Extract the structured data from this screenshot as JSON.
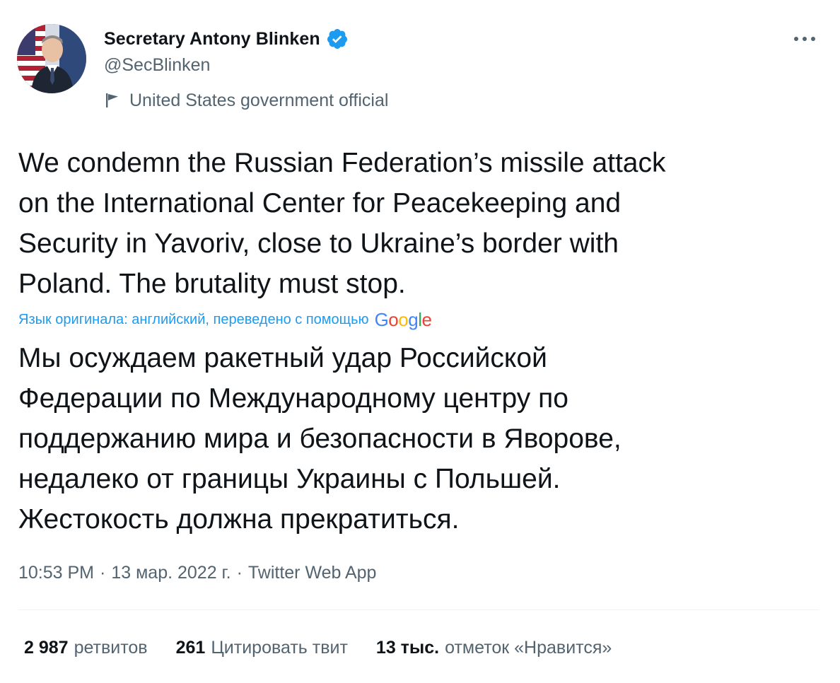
{
  "author": {
    "display_name": "Secretary Antony Blinken",
    "handle": "@SecBlinken",
    "label": "United States government official",
    "verified": true
  },
  "tweet": {
    "text": "We condemn the Russian Federation’s missile attack\non the International Center for Peacekeeping and\nSecurity in Yavoriv, close to Ukraine’s border with\nPoland. The brutality must stop.",
    "translation_note": "Язык оригинала: английский, переведено с помощью",
    "translation_provider": "Google",
    "translated_text": "Мы осуждаем ракетный удар Российской\nФедерации по Международному центру по\nподдержанию мира и безопасности в Яворове,\nнедалеко от границы Украины с Польшей.\nЖестокость должна прекратиться."
  },
  "meta": {
    "time": "10:53 PM",
    "date": "13 мар. 2022 г.",
    "source": "Twitter Web App",
    "separator": "·"
  },
  "stats": {
    "retweets_count": "2 987",
    "retweets_label": "ретвитов",
    "quotes_count": "261",
    "quotes_label": "Цитировать твит",
    "likes_count": "13 тыс.",
    "likes_label": "отметок «Нравится»"
  },
  "colors": {
    "text_primary": "#0f1419",
    "text_secondary": "#536471",
    "accent": "#1d9bf0",
    "divider": "#eff3f4"
  },
  "icons": {
    "verified": "verified-badge-icon",
    "label": "flag-icon",
    "more": "more-dots-icon"
  }
}
